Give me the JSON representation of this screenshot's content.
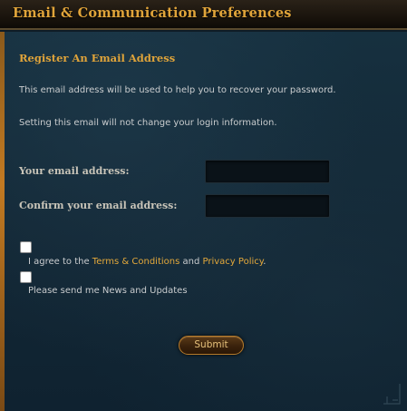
{
  "window": {
    "title": "Email & Communication Preferences"
  },
  "section": {
    "heading": "Register An Email Address",
    "info_line_1": "This email address will be used to help you to recover your password.",
    "info_line_2": "Setting this email will not change your login information."
  },
  "form": {
    "email_label": "Your email address:",
    "email_value": "",
    "confirm_label": "Confirm your email address:",
    "confirm_value": ""
  },
  "agreement": {
    "checked": false,
    "prefix": "I agree to the ",
    "terms_link": "Terms & Conditions",
    "middle": " and ",
    "privacy_link": "Privacy Policy",
    "suffix": "."
  },
  "newsletter": {
    "checked": false,
    "label": "Please send me News and Updates"
  },
  "submit": {
    "label": "Submit"
  },
  "colors": {
    "accent": "#e0a43a",
    "link": "#e3a83b",
    "panel_bg": "#132836",
    "text": "#c9ccce"
  }
}
